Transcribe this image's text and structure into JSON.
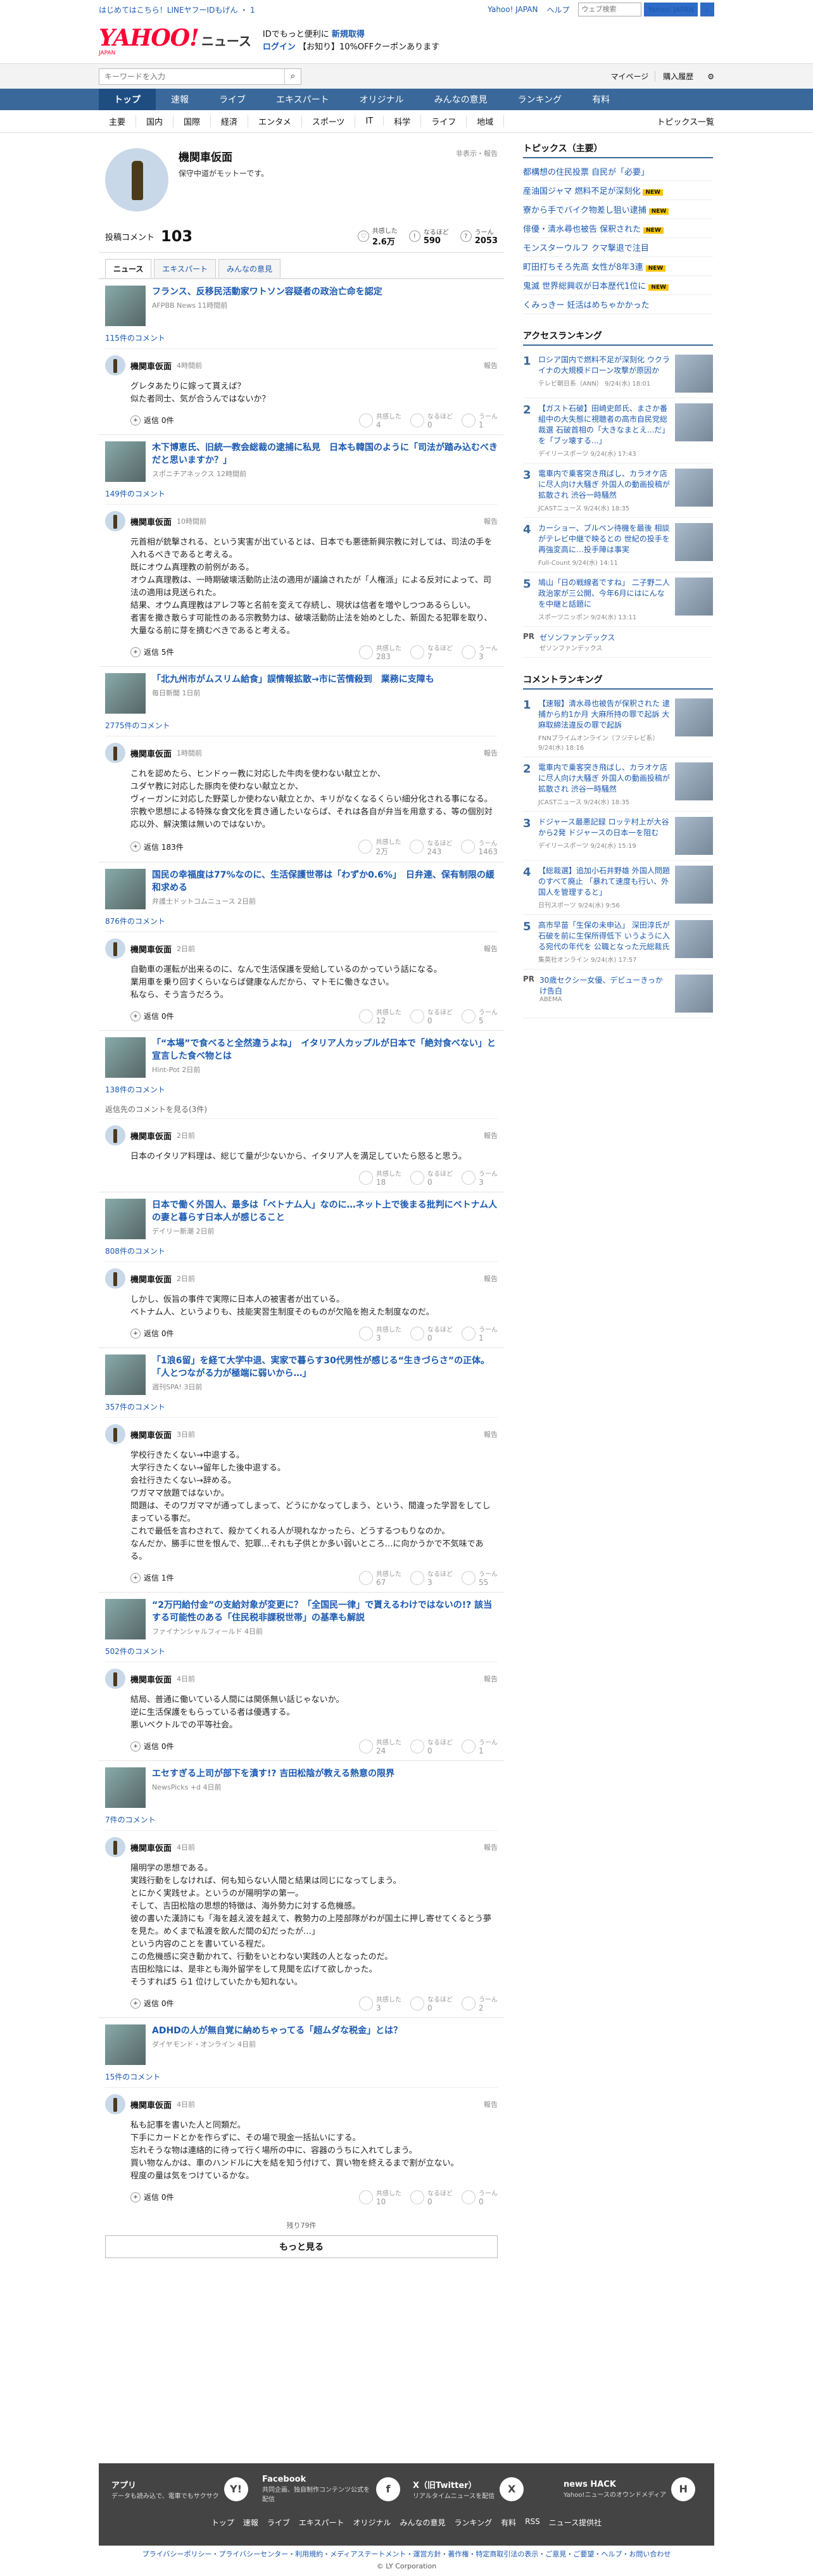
{
  "topline": {
    "left": "はじめてはこちら！LINEヤフーIDもげん ・ 1",
    "login": "Yahoo! JAPAN",
    "help": "ヘルプ",
    "search_placeholder": "ウェブ検索",
    "search_btn": "Yahoo! JAPAN"
  },
  "header": {
    "logo": "YAHOO!",
    "logo_sub": "JAPAN",
    "news": "ニュース",
    "promo1": "IDでもっと便利に",
    "promo1b": "新規取得",
    "promo2": "ログイン",
    "promo3": "【お知り】10%OFFクーポンあります"
  },
  "searchbar": {
    "placeholder": "キーワードを入力",
    "mypage": "マイページ",
    "purchased": "購入履歴"
  },
  "gnav": [
    "トップ",
    "速報",
    "ライブ",
    "エキスパート",
    "オリジナル",
    "みんなの意見",
    "ランキング",
    "有料"
  ],
  "snav": [
    "主要",
    "国内",
    "国際",
    "経済",
    "エンタメ",
    "スポーツ",
    "IT",
    "科学",
    "ライフ",
    "地域"
  ],
  "snav_all": "トピックス一覧",
  "profile": {
    "name": "機関車仮面",
    "desc": "保守中道がモットーです。",
    "follow_note": "非表示・報告"
  },
  "stats": {
    "label": "投稿コメント",
    "count": "103",
    "s1_label": "共感した",
    "s1": "2.6万",
    "s2_label": "なるほど",
    "s2": "590",
    "s3_label": "うーん",
    "s3": "2053"
  },
  "tabs": [
    "ニュース",
    "エキスパート",
    "みんなの意見"
  ],
  "articles": [
    {
      "title": "フランス、反移民活動家ワトソン容疑者の政治亡命を認定",
      "src": "AFPBB News 11時間前",
      "count": "115件のコメント",
      "comments": [
        {
          "time": "4時間前",
          "text": "グレタあたりに嫁って貰えば？\n似た者同士、気が合うんではないか？",
          "reply": "返信 0件",
          "r": [
            "4",
            "0",
            "1"
          ]
        }
      ]
    },
    {
      "title": "木下博恵氏、旧統一教会総裁の逮捕に私見　日本も韓国のように「司法が踏み込むべきだと思いますか？」",
      "src": "スポニチアネックス 12時間前",
      "count": "149件のコメント",
      "comments": [
        {
          "time": "10時間前",
          "text": "元首相が銃撃される、という実害が出ているとは、日本でも悪徳新興宗教に対しては、司法の手を入れるべきであると考える。\n既にオウム真理教の前例がある。\nオウム真理教は、一時期破壊活動防止法の適用が議論されたが「人権派」による反対によって、司法の適用は見送られた。\n結果、オウム真理教はアレフ等と名前を変えて存続し、現状は信者を増やしつつあるらしい。\n者害を撒き散らす可能性のある宗教勢力は、破壊活動防止法を始めとした、新固たる犯罪を取り、大量なる前に芽を摘むべきであると考える。",
          "reply": "返信 5件",
          "r": [
            "283",
            "7",
            "3"
          ]
        }
      ]
    },
    {
      "title": "「北九州市がムスリム給食」誤情報拡散→市に苦情殺到　業務に支障も",
      "src": "毎日新聞 1日前",
      "count": "2775件のコメント",
      "comments": [
        {
          "time": "1時間前",
          "text": "これを認めたら、ヒンドゥー教に対応した牛肉を使わない献立とか、\nユダヤ教に対応した豚肉を使わない献立とか、\nヴィーガンに対応した野菜しか使わない献立とか、キリがなくなるくらい細分化される事になる。\n宗教や思想による特殊な食文化を貫き通したいならば、それは各自が弁当を用意する、等の個別対応以外、解決策は無いのではないか。",
          "reply": "返信 183件",
          "r": [
            "2万",
            "243",
            "1463"
          ]
        }
      ]
    },
    {
      "title": "国民の幸福度は77%なのに、生活保護世帯は「わずか0.6%」　日弁連、保有制限の緩和求める",
      "src": "弁護士ドットコムニュース 2日前",
      "count": "876件のコメント",
      "comments": [
        {
          "time": "2日前",
          "text": "自動車の運転が出来るのに、なんで生活保護を受給しているのかっていう話になる。\n業用車を乗り回すくらいならば健康なんだから、マトモに働きなさい。\n私なら、そう言うだろう。",
          "reply": "返信 0件",
          "r": [
            "12",
            "0",
            "5"
          ]
        }
      ]
    },
    {
      "title": "「“本場”で食べると全然違うよね」　イタリア人カップルが日本で「絶対食べない」と宣言した食べ物とは",
      "src": "Hint-Pot 2日前",
      "count": "138件のコメント",
      "deleted": "返信先のコメントを見る(3件)",
      "comments": [
        {
          "time": "2日前",
          "text": "日本のイタリア料理は、総じて量が少ないから、イタリア人を満足していたら怒ると思う。",
          "reply": "",
          "r": [
            "18",
            "0",
            "3"
          ]
        }
      ]
    },
    {
      "title": "日本で働く外国人、最多は「ベトナム人」なのに…ネット上で後まる批判にベトナム人の妻と暮らす日本人が感じること",
      "src": "デイリー新潮 2日前",
      "count": "808件のコメント",
      "comments": [
        {
          "time": "2日前",
          "text": "しかし、仮旨の事件で実際に日本人の被害者が出ている。\nベトナム人、というよりも、技能実習生制度そのものが欠陥を抱えた制度なのだ。",
          "reply": "返信 0件",
          "r": [
            "3",
            "0",
            "1"
          ]
        }
      ]
    },
    {
      "title": "「1浪6留」を経て大学中退、実家で暮らす30代男性が感じる“生きづらさ”の正体。「人とつながる力が極端に弱いから…」",
      "src": "週刊SPA! 3日前",
      "count": "357件のコメント",
      "comments": [
        {
          "time": "3日前",
          "text": "学校行きたくない→中退する。\n大学行きたくない→留年した後中退する。\n会社行きたくない→辞める。\nワガママ放題ではないか。\n問題は、そのワガママが通ってしまって、どうにかなってしまう、という、間違った学習をしてしまっている事だ。\nこれで最低を言わされて、殺かてくれる人が現れなかったら、どうするつもりなのか。\nなんだか、勝手に世を恨んで、犯罪…それも子供とか多い弱いところ…に向かうかで不気味である。",
          "reply": "返信 1件",
          "r": [
            "67",
            "3",
            "55"
          ]
        }
      ]
    },
    {
      "title": "“2万円給付金”の支給対象が変更に？「全国民一律」で貰えるわけではないの!? 該当する可能性のある「住民税非課税世帯」の基準も解説",
      "src": "ファイナンシャルフィールド 4日前",
      "count": "502件のコメント",
      "comments": [
        {
          "time": "4日前",
          "text": "結局、普通に働いている人間には関係無い話じゃないか。\n逆に生活保護をもらっている者は優遇する。\n悪いベクトルでの平等社会。",
          "reply": "返信 0件",
          "r": [
            "24",
            "0",
            "1"
          ]
        }
      ]
    },
    {
      "title": "エセすぎる上司が部下を潰す!? 吉田松陰が教える熱意の限界",
      "src": "NewsPicks +d 4日前",
      "count": "7件のコメント",
      "comments": [
        {
          "time": "4日前",
          "text": "陽明学の思想である。\n実践行動をしなければ、何も知らない人間と結果は同じになってしまう。\nとにかく実践せよ。というのが陽明学の第一。\nそして、吉田松陰の思想的特徴は、海外勢力に対する危機感。\n彼の書いた漢詩にも「海を越え波を越えて、教勢力の上陸部隊がわが国土に押し寄せてくるとう夢を見た。めくまで私渡を飲んだ間の幻だったが…」\nという内容のことを書いている程だ。\nこの危機感に突き動かれて、行動をいとわない実践の人となったのだ。\n吉田松陰には、是非とも海外留学をして見聞を広げて欲しかった。\nそうすれば5 ら1 位けしていたかも知れない。",
          "reply": "返信 0件",
          "r": [
            "3",
            "0",
            "2"
          ]
        }
      ]
    },
    {
      "title": "ADHDの人が無自覚に納めちゃってる「超ムダな税金」とは？",
      "src": "ダイヤモンド・オンライン 4日前",
      "count": "15件のコメント",
      "comments": [
        {
          "time": "4日前",
          "text": "私も記事を書いた人と同類だ。\n下手にカードとかを作らずに、その場で現金一括払いにする。\n忘れそうな物は連絡的に待って行く場所の中に、容器のうちに入れてしまう。\n買い物なんかは、車のハンドルに大を結を知う付けて、買い物を終えるまで割が立ない。\n程度の量は気をつけているかな。",
          "reply": "返信 0件",
          "r": [
            "10",
            "0",
            "0"
          ]
        }
      ]
    }
  ],
  "more": {
    "remaining": "残り79件",
    "button": "もっと見る"
  },
  "side": {
    "topics_title": "トピックス（主要）",
    "topics": [
      {
        "t": "都構想の住民投票 自民が「必要」",
        "n": ""
      },
      {
        "t": "産油国ジャマ 燃料不足が深刻化",
        "n": "NEW"
      },
      {
        "t": "寮から手でバイク物差し狙い逮捕",
        "n": "NEW"
      },
      {
        "t": "俳優・清水尋也被告 保釈された",
        "n": "NEW"
      },
      {
        "t": "モンスターウルフ クマ撃退で注目",
        "n": ""
      },
      {
        "t": "町田打ちそろ先高 女性が8年3連",
        "n": "NEW"
      },
      {
        "t": "鬼滅 世界総興収が日本歴代1位に",
        "n": "NEW"
      },
      {
        "t": "くみっきー 妊活はめちゃかかった",
        "n": ""
      }
    ],
    "access_title": "アクセスランキング",
    "access": [
      {
        "t": "ロシア国内で燃料不足が深刻化 ウクライナの大規模ドローン攻撃が原因か",
        "s": "テレビ朝日系（ANN） 9/24(水) 18:01"
      },
      {
        "t": "【ガスト石破】田崎史郎氏、まさか番組中の大失態に視聴者の高市自民党総裁選 石破首相の「大きなまとえ...だ」を「ブッ壊する...」",
        "s": "デイリースポーツ 9/24(水) 17:43"
      },
      {
        "t": "電車内で乗客突き飛ばし、カラオケ店に尽人向け大騒ぎ 外国人の動画投稿が拡散され 渋谷一時騒然",
        "s": "JCASTニュース 9/24(水) 18:35"
      },
      {
        "t": "カーショー、ブルペン待機を最後 相談がテレビ中継で映るとの 世紀の投手を再強変高に…投手陣は事実",
        "s": "Full-Count 9/24(水) 14:11"
      },
      {
        "t": "鳩山「日の戦線者ですね」 二子野二人政治家が三公開、今年6月にはにんなを中継と話題に",
        "s": "スポーツニッポン 9/24(水) 13:11"
      }
    ],
    "access_pr": {
      "pt": "PR",
      "t": "ゼソンファンデックス",
      "s": "ゼソンファンデックス"
    },
    "comment_title": "コメントランキング",
    "comrank": [
      {
        "t": "【速報】清水尋也被告が保釈された 逮捕から約1か月 大麻所持の罪で起訴 大麻取締法違反の罪で起訴",
        "s": "FNNプライムオンライン（フジテレビ系） 9/24(水) 18:16"
      },
      {
        "t": "電車内で乗客突き飛ばし、カラオケ店に尽人向け大騒ぎ 外国人の動画投稿が拡散され 渋谷一時騒然",
        "s": "JCASTニュース 9/24(水) 18:35"
      },
      {
        "t": "ドジャース最悪記録 ロッテ村上が大谷から2発 ドジャースの日本一を阻む",
        "s": "デイリースポーツ 9/24(水) 15:19"
      },
      {
        "t": "【総裁選】追加小石井野雄 外国人問題のすべて廃止 「暴れて速度も行い、外国人を管理すると」",
        "s": "日刊スポーツ 9/24(水) 9:56"
      },
      {
        "t": "高市早苗「生保の未申込」 深田淳氏が石破を前に生保所得低下 いうように入る宛代の年代を 公職となった元総裁氏",
        "s": "集英社オンライン 9/24(水) 17:57"
      }
    ],
    "com_pr": {
      "pt": "PR",
      "t": "30歳セクシー女優、デビューきっかけ告白",
      "s": "ABEMA"
    }
  },
  "footer": {
    "boxes": [
      {
        "tt": "アプリ",
        "dd": "データも読み込で、電車でもサクサク",
        "ic": "Y!"
      },
      {
        "tt": "Facebook",
        "dd": "共同企画、独自制作コンテンツ公式を配信",
        "ic": "f"
      },
      {
        "tt": "X（旧Twitter）",
        "dd": "リアルタイムニュースを配信",
        "ic": "X"
      },
      {
        "tt": "news HACK",
        "dd": "Yahoo!ニュースのオウンドメディア",
        "ic": "H"
      }
    ],
    "links": [
      "トップ",
      "速報",
      "ライブ",
      "エキスパート",
      "オリジナル",
      "みんなの意見",
      "ランキング",
      "有料",
      "RSS",
      "ニュース提供社"
    ],
    "legal": "プライバシーポリシー・プライバシーセンター・利用規約・メディアステートメント・運営方針・著作権・特定商取引法の表示・ご意見・ご要望・ヘルプ・お問い合わせ",
    "copy": "© LY Corporation"
  }
}
